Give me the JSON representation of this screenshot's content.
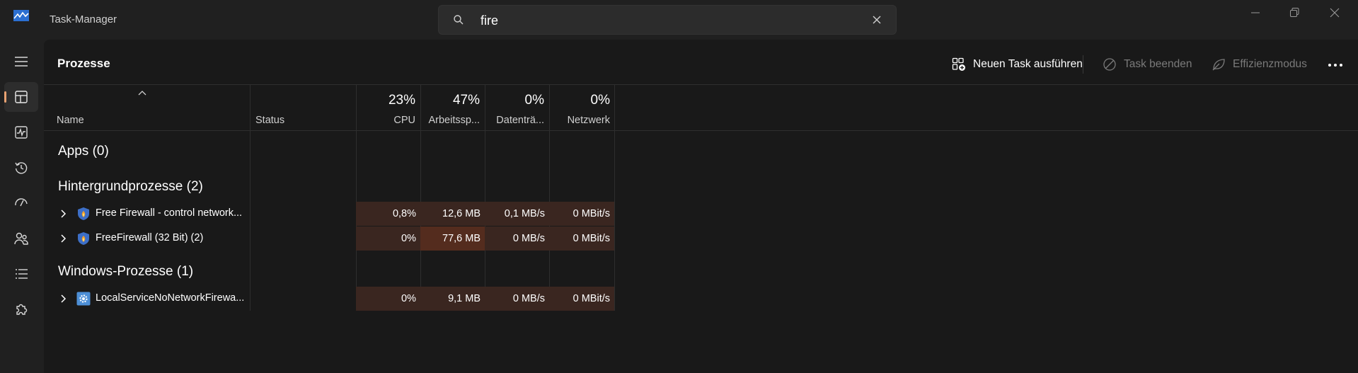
{
  "window": {
    "title": "Task-Manager"
  },
  "search": {
    "value": "fire"
  },
  "page": {
    "title": "Prozesse"
  },
  "toolbar": {
    "run_task": "Neuen Task ausführen",
    "end_task": "Task beenden",
    "efficiency": "Effizienzmodus"
  },
  "columns": {
    "name": "Name",
    "status": "Status",
    "cpu": {
      "label": "CPU",
      "pct": "23%"
    },
    "memory": {
      "label": "Arbeitssp...",
      "pct": "47%"
    },
    "disk": {
      "label": "Datenträ...",
      "pct": "0%"
    },
    "network": {
      "label": "Netzwerk",
      "pct": "0%"
    }
  },
  "groups": {
    "apps": "Apps (0)",
    "background": "Hintergrundprozesse (2)",
    "windows": "Windows-Prozesse (1)"
  },
  "rows": [
    {
      "name": "Free Firewall - control network...",
      "cpu": "0,8%",
      "memory": "12,6 MB",
      "disk": "0,1 MB/s",
      "network": "0 MBit/s",
      "icon": "firewall-shield-icon"
    },
    {
      "name": "FreeFirewall (32 Bit) (2)",
      "cpu": "0%",
      "memory": "77,6 MB",
      "disk": "0 MB/s",
      "network": "0 MBit/s",
      "icon": "firewall-shield-icon"
    },
    {
      "name": "LocalServiceNoNetworkFirewa...",
      "cpu": "0%",
      "memory": "9,1 MB",
      "disk": "0 MB/s",
      "network": "0 MBit/s",
      "icon": "service-gear-icon"
    }
  ],
  "colors": {
    "accent": "#e8a272",
    "heat_low": "#3a2620",
    "heat_high": "#542c1e"
  }
}
